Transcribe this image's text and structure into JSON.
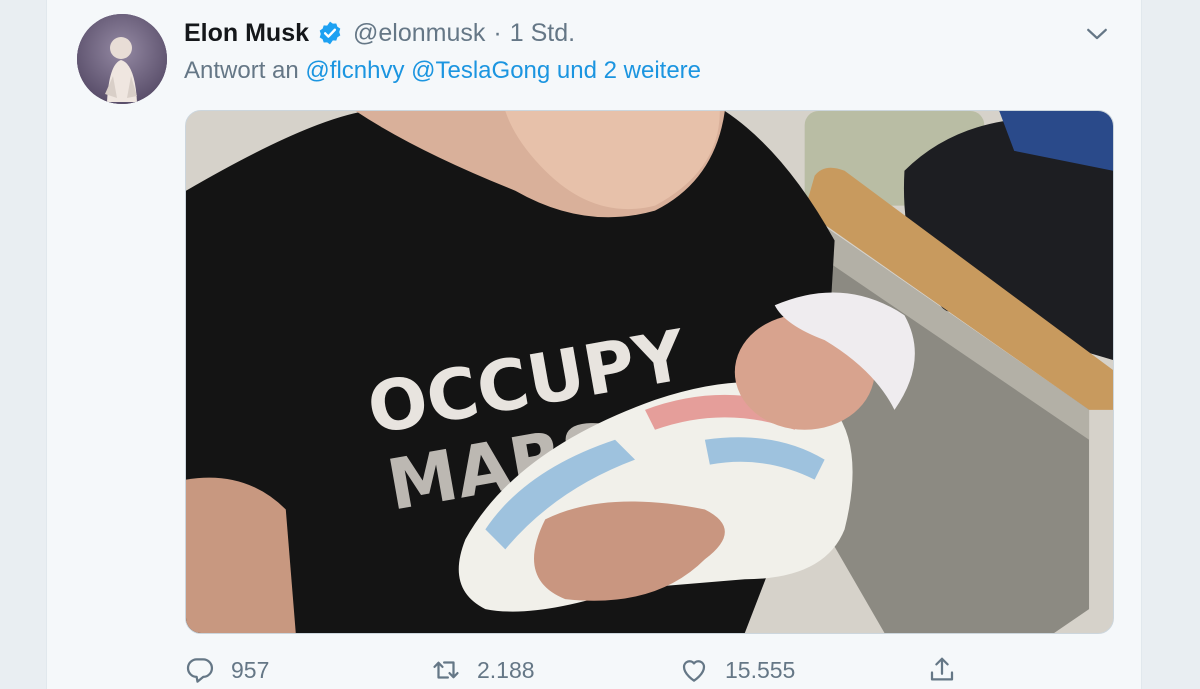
{
  "tweet": {
    "author_name": "Elon Musk",
    "handle": "@elonmusk",
    "separator": "·",
    "time": "1 Std.",
    "reply_prefix": "Antwort an",
    "mentions": [
      "@flcnhvy",
      "@TeslaGong",
      "und 2 weitere"
    ],
    "shirt_text_line1": "OCCUPY",
    "shirt_text_line2": "MARS"
  },
  "actions": {
    "reply_count": "957",
    "retweet_count": "2.188",
    "like_count": "15.555"
  },
  "icons": {
    "verified": "verified-badge-icon",
    "caret": "chevron-down-icon",
    "reply": "reply-bubble-icon",
    "retweet": "retweet-icon",
    "like": "heart-icon",
    "share": "share-upload-icon"
  },
  "colors": {
    "link": "#1b95e0",
    "muted": "#657786",
    "text": "#14171a",
    "verified": "#1da1f2"
  }
}
